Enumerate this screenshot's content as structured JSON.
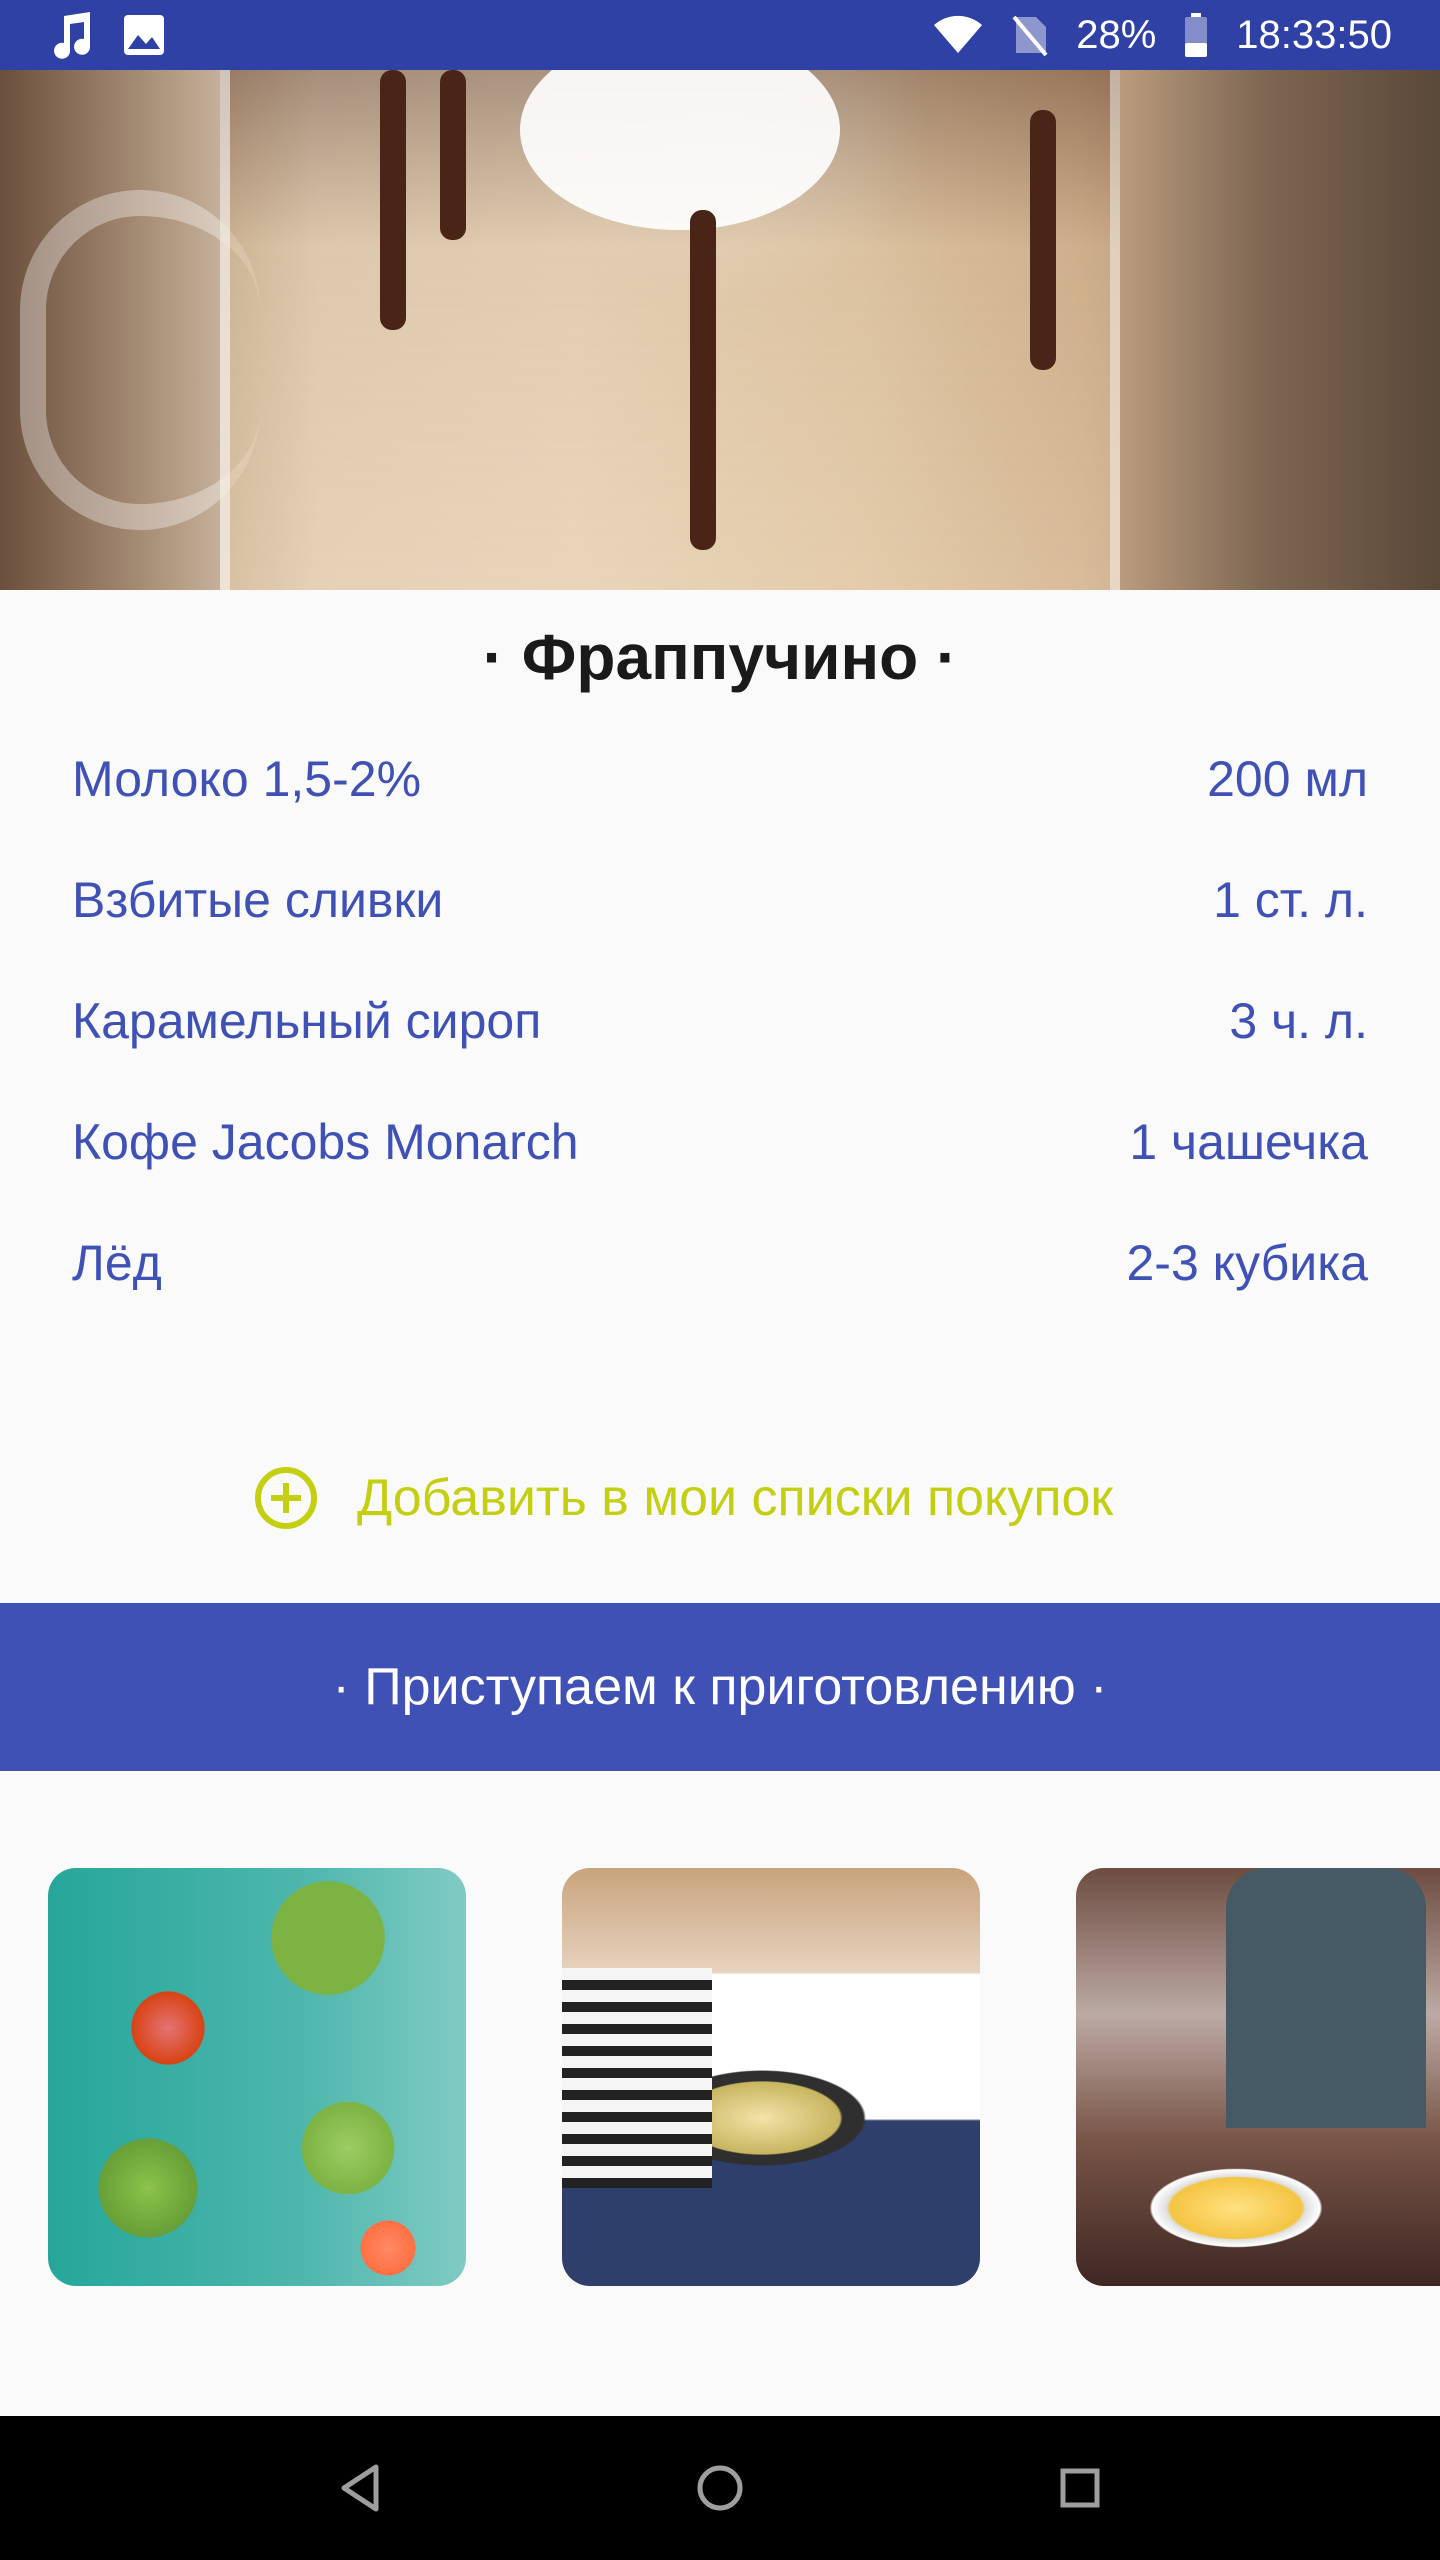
{
  "status_bar": {
    "icons_left": [
      "music-note-icon",
      "image-icon"
    ],
    "icons_right": [
      "wifi-icon",
      "no-sim-icon",
      "battery-icon"
    ],
    "battery": "28%",
    "time": "18:33:50"
  },
  "recipe": {
    "title": "· Фраппучино ·",
    "ingredients": [
      {
        "name": "Молоко 1,5-2%",
        "amount": "200 мл"
      },
      {
        "name": "Взбитые сливки",
        "amount": "1 ст. л."
      },
      {
        "name": "Карамельный сироп",
        "amount": "3 ч. л."
      },
      {
        "name": "Кофе Jacobs Monarch",
        "amount": "1 чашечка"
      },
      {
        "name": "Лёд",
        "amount": "2-3 кубика"
      }
    ],
    "add_to_list_label": "Добавить в мои списки покупок",
    "cook_banner_label": "· Приступаем к приготовлению ·"
  },
  "colors": {
    "status_bar": "#3041a5",
    "accent_blue": "#3f51b5",
    "accent_lime": "#c4cf12",
    "title_text": "#1a1a1a"
  },
  "nav_bar": {
    "buttons": [
      "back-icon",
      "home-icon",
      "recents-icon"
    ]
  }
}
